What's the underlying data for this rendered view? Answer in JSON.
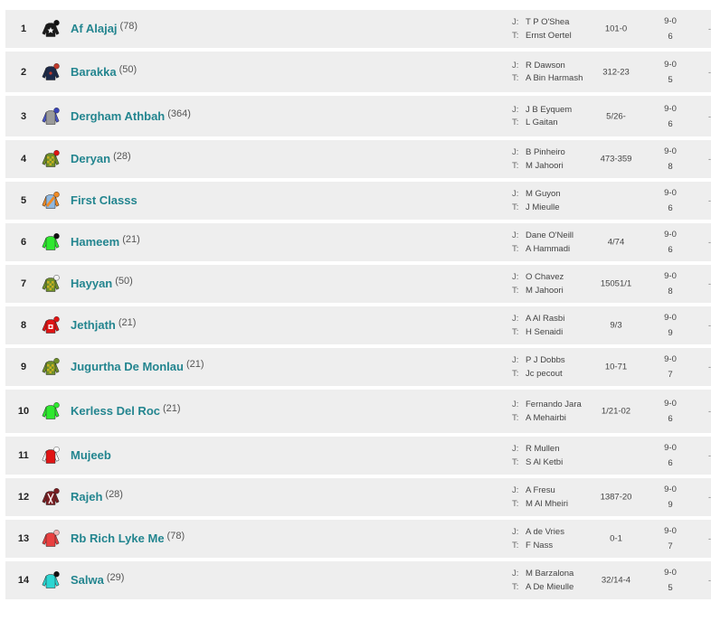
{
  "runners": [
    {
      "number": "1",
      "name": "Af Alajaj",
      "rating": "(78)",
      "jockey": "T P O'Shea",
      "trainer": "Ernst Oertel",
      "form": "101-0",
      "weight": "9-0",
      "draw": "6",
      "silk": {
        "body": "#1a1a1a",
        "sleeves": "#1a1a1a",
        "cap": "#111111",
        "emblem": "star-white"
      }
    },
    {
      "number": "2",
      "name": "Barakka",
      "rating": "(50)",
      "jockey": "R Dawson",
      "trainer": "A Bin Harmash",
      "form": "312-23",
      "weight": "9-0",
      "draw": "5",
      "silk": {
        "body": "#1c2a4a",
        "sleeves": "#1c2a4a",
        "cap": "#c0392b",
        "emblem": "dot-red"
      }
    },
    {
      "number": "3",
      "name": "Dergham Athbah",
      "rating": "(364)",
      "jockey": "J B Eyquem",
      "trainer": "L Gaitan",
      "form": "5/26-",
      "weight": "9-0",
      "draw": "6",
      "silk": {
        "body": "#9a9a9a",
        "sleeves": "#4a56c8",
        "cap": "#3b45b8",
        "emblem": "none"
      }
    },
    {
      "number": "4",
      "name": "Deryan",
      "rating": "(28)",
      "jockey": "B Pinheiro",
      "trainer": "M Jahoori",
      "form": "473-359",
      "weight": "9-0",
      "draw": "8",
      "silk": {
        "body": "#6f8f2a",
        "sleeves": "#6f8f2a",
        "cap": "#e01414",
        "emblem": "check"
      }
    },
    {
      "number": "5",
      "name": "First Classs",
      "rating": "",
      "jockey": "M Guyon",
      "trainer": "J Mieulle",
      "form": "",
      "weight": "9-0",
      "draw": "6",
      "silk": {
        "body": "#8fb8e0",
        "sleeves": "#f08a24",
        "cap": "#f08a24",
        "emblem": "sash-orange"
      }
    },
    {
      "number": "6",
      "name": "Hameem",
      "rating": "(21)",
      "jockey": "Dane O'Neill",
      "trainer": "A Hammadi",
      "form": "4/74",
      "weight": "9-0",
      "draw": "6",
      "silk": {
        "body": "#2ee82e",
        "sleeves": "#2ee82e",
        "cap": "#111111",
        "emblem": "none"
      }
    },
    {
      "number": "7",
      "name": "Hayyan",
      "rating": "(50)",
      "jockey": "O Chavez",
      "trainer": "M Jahoori",
      "form": "15051/1",
      "weight": "9-0",
      "draw": "8",
      "silk": {
        "body": "#6f8f2a",
        "sleeves": "#6f8f2a",
        "cap": "#f2f2f2",
        "emblem": "check"
      }
    },
    {
      "number": "8",
      "name": "Jethjath",
      "rating": "(21)",
      "jockey": "A Al Rasbi",
      "trainer": "H Senaidi",
      "form": "9/3",
      "weight": "9-0",
      "draw": "9",
      "silk": {
        "body": "#e01414",
        "sleeves": "#e01414",
        "cap": "#e01414",
        "emblem": "square-white"
      }
    },
    {
      "number": "9",
      "name": "Jugurtha De Monlau",
      "rating": "(21)",
      "jockey": "P J Dobbs",
      "trainer": "Jc pecout",
      "form": "10-71",
      "weight": "9-0",
      "draw": "7",
      "silk": {
        "body": "#6f8f2a",
        "sleeves": "#6f8f2a",
        "cap": "#6f8f2a",
        "emblem": "check"
      }
    },
    {
      "number": "10",
      "name": "Kerless Del Roc",
      "rating": "(21)",
      "jockey": "Fernando Jara",
      "trainer": "A Mehairbi",
      "form": "1/21-02",
      "weight": "9-0",
      "draw": "6",
      "silk": {
        "body": "#2ee82e",
        "sleeves": "#2ee82e",
        "cap": "#2ee82e",
        "emblem": "none"
      }
    },
    {
      "number": "11",
      "name": "Mujeeb",
      "rating": "",
      "jockey": "R Mullen",
      "trainer": "S Al Ketbi",
      "form": "",
      "weight": "9-0",
      "draw": "6",
      "silk": {
        "body": "#e01414",
        "sleeves": "#ffffff",
        "cap": "#ffffff",
        "emblem": "none"
      }
    },
    {
      "number": "12",
      "name": "Rajeh",
      "rating": "(28)",
      "jockey": "A Fresu",
      "trainer": "M Al Mheiri",
      "form": "1387-20",
      "weight": "9-0",
      "draw": "9",
      "silk": {
        "body": "#7a1e22",
        "sleeves": "#7a1e22",
        "cap": "#7a1e22",
        "emblem": "braces-white"
      }
    },
    {
      "number": "13",
      "name": "Rb Rich Lyke Me",
      "rating": "(78)",
      "jockey": "A de Vries",
      "trainer": "F Nass",
      "form": "0-1",
      "weight": "9-0",
      "draw": "7",
      "silk": {
        "body": "#e84040",
        "sleeves": "#e84040",
        "cap": "#f3b0b0",
        "emblem": "none"
      }
    },
    {
      "number": "14",
      "name": "Salwa",
      "rating": "(29)",
      "jockey": "M Barzalona",
      "trainer": "A De Mieulle",
      "form": "32/14-4",
      "weight": "9-0",
      "draw": "5",
      "silk": {
        "body": "#2bd6d2",
        "sleeves": "#2bd6d2",
        "cap": "#111111",
        "emblem": "none"
      }
    }
  ],
  "labels": {
    "jockey": "J:",
    "trainer": "T:"
  },
  "more_glyph": "-"
}
